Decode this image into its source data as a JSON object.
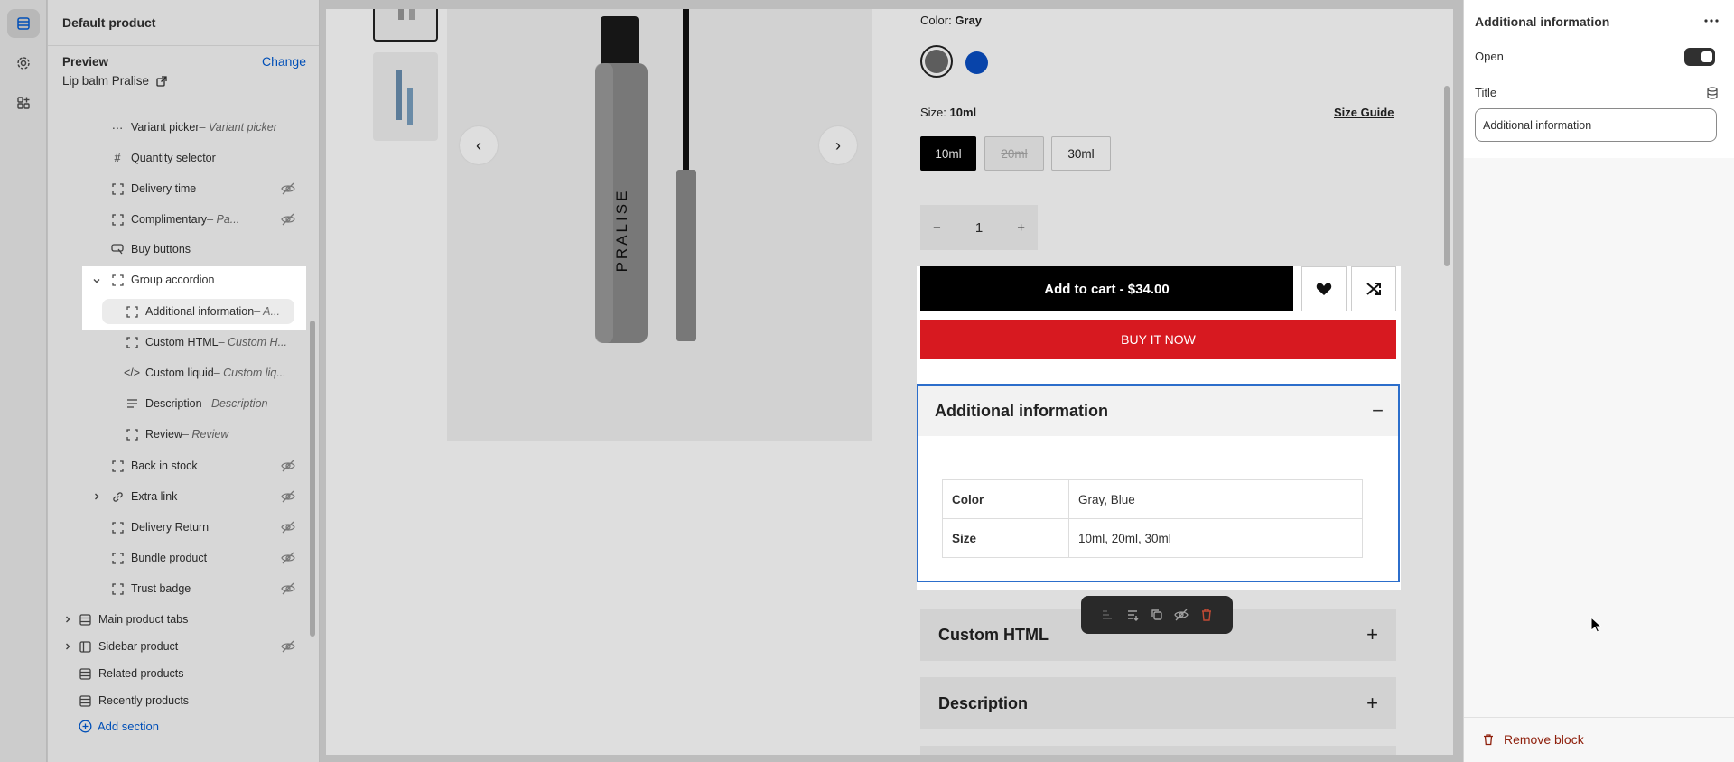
{
  "left_panel": {
    "title": "Default product",
    "preview_label": "Preview",
    "preview_change": "Change",
    "preview_value": "Lip balm Pralise",
    "tree": [
      {
        "label": "Variant picker",
        "sub": " – Variant picker",
        "hidden": false
      },
      {
        "label": "Quantity selector",
        "sub": "",
        "hidden": false
      },
      {
        "label": "Delivery time",
        "sub": "",
        "hidden": true
      },
      {
        "label": "Complimentary",
        "sub": " – Pa...",
        "hidden": true
      },
      {
        "label": "Buy buttons",
        "sub": "",
        "hidden": false
      },
      {
        "label": "Group accordion",
        "sub": "",
        "hidden": false
      },
      {
        "label": "Additional information",
        "sub": " – A...",
        "hidden": false
      },
      {
        "label": "Custom HTML",
        "sub": " – Custom H...",
        "hidden": false
      },
      {
        "label": "Custom liquid",
        "sub": " – Custom liq...",
        "hidden": false
      },
      {
        "label": "Description",
        "sub": " – Description",
        "hidden": false
      },
      {
        "label": "Review",
        "sub": " – Review",
        "hidden": false
      },
      {
        "label": "Back in stock",
        "sub": "",
        "hidden": true
      },
      {
        "label": "Extra link",
        "sub": "",
        "hidden": true
      },
      {
        "label": "Delivery Return",
        "sub": "",
        "hidden": true
      },
      {
        "label": "Bundle product",
        "sub": "",
        "hidden": true
      },
      {
        "label": "Trust badge",
        "sub": "",
        "hidden": true
      },
      {
        "label": "Main product tabs",
        "sub": "",
        "hidden": false
      },
      {
        "label": "Sidebar product",
        "sub": "",
        "hidden": true
      },
      {
        "label": "Related products",
        "sub": "",
        "hidden": false
      },
      {
        "label": "Recently products",
        "sub": "",
        "hidden": false
      }
    ],
    "add_section": "Add section"
  },
  "product": {
    "brand_text": "PRALISE",
    "color_label": "Color:",
    "color_value": "Gray",
    "colors": [
      "#6b6b6b",
      "#0a4fc4"
    ],
    "size_label": "Size:",
    "size_value": "10ml",
    "size_guide": "Size Guide",
    "sizes": [
      "10ml",
      "20ml",
      "30ml"
    ],
    "quantity": "1",
    "qty_minus": "−",
    "qty_plus": "+",
    "add_to_cart": "Add to cart - $34.00",
    "buy_now": "BUY IT NOW",
    "accordion_additional": "Additional information",
    "accordion_collapse_symbol": "−",
    "accordion_expand_symbol": "+",
    "specs": [
      {
        "key": "Color",
        "value": "Gray, Blue"
      },
      {
        "key": "Size",
        "value": "10ml, 20ml, 30ml"
      }
    ],
    "accordion_custom_html": "Custom HTML",
    "accordion_description": "Description",
    "arrow_prev": "‹",
    "arrow_next": "›"
  },
  "right_panel": {
    "title": "Additional information",
    "open_label": "Open",
    "open_state": true,
    "title_label": "Title",
    "title_value": "Additional information",
    "remove_block": "Remove block"
  }
}
